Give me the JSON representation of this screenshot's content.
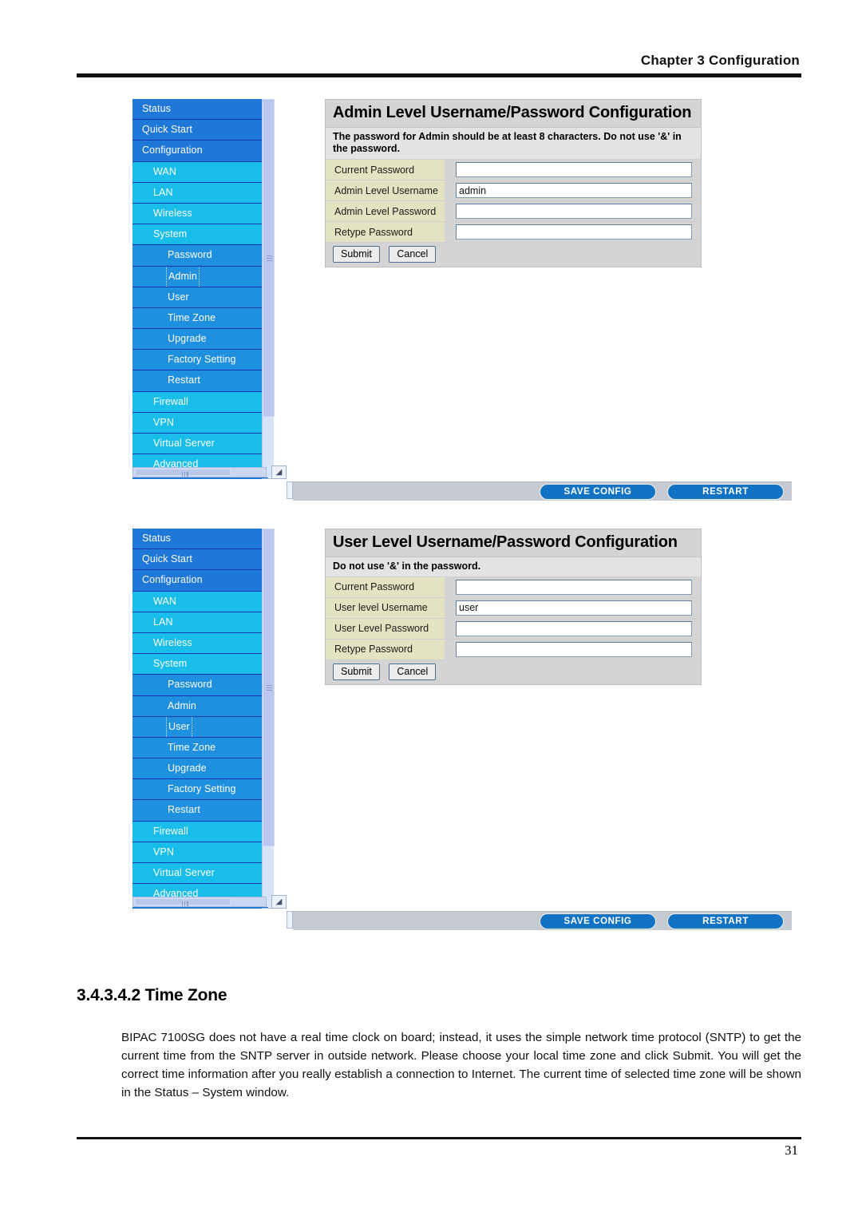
{
  "page": {
    "chapter_header": "Chapter 3 Configuration",
    "page_number": "31"
  },
  "menu": {
    "items": [
      {
        "label": "Status",
        "level": 0
      },
      {
        "label": "Quick Start",
        "level": 0
      },
      {
        "label": "Configuration",
        "level": 0
      },
      {
        "label": "WAN",
        "level": 1
      },
      {
        "label": "LAN",
        "level": 1
      },
      {
        "label": "Wireless",
        "level": 1
      },
      {
        "label": "System",
        "level": 1
      },
      {
        "label": "Password",
        "level": 2,
        "style": "blue"
      },
      {
        "label": "Admin",
        "level": 2,
        "style": "blue"
      },
      {
        "label": "User",
        "level": 2,
        "style": "blue"
      },
      {
        "label": "Time Zone",
        "level": 2,
        "style": "blue"
      },
      {
        "label": "Upgrade",
        "level": 2,
        "style": "blue"
      },
      {
        "label": "Factory Setting",
        "level": 2,
        "style": "blue"
      },
      {
        "label": "Restart",
        "level": 2,
        "style": "blue"
      },
      {
        "label": "Firewall",
        "level": 1
      },
      {
        "label": "VPN",
        "level": 1
      },
      {
        "label": "Virtual Server",
        "level": 1
      },
      {
        "label": "Advanced",
        "level": 1
      },
      {
        "label": "Save Config",
        "level": 0
      }
    ],
    "selected_admin": "Admin",
    "selected_user": "User"
  },
  "admin_panel": {
    "title": "Admin Level Username/Password Configuration",
    "note": "The password for Admin should be at least 8 characters. Do not use '&' in the password.",
    "fields": [
      {
        "label": "Current Password",
        "value": ""
      },
      {
        "label": "Admin Level Username",
        "value": "admin"
      },
      {
        "label": "Admin Level Password",
        "value": ""
      },
      {
        "label": "Retype Password",
        "value": ""
      }
    ],
    "submit_label": "Submit",
    "cancel_label": "Cancel"
  },
  "user_panel": {
    "title": "User Level Username/Password Configuration",
    "note": "Do not use '&' in the password.",
    "fields": [
      {
        "label": "Current Password",
        "value": ""
      },
      {
        "label": "User level Username",
        "value": "user"
      },
      {
        "label": "User Level Password",
        "value": ""
      },
      {
        "label": "Retype Password",
        "value": ""
      }
    ],
    "submit_label": "Submit",
    "cancel_label": "Cancel"
  },
  "action_bar": {
    "save_config_label": "SAVE CONFIG",
    "restart_label": "RESTART"
  },
  "section": {
    "heading": "3.4.3.4.2 Time Zone",
    "paragraph": "BIPAC 7100SG does not have a real time clock on board; instead, it uses the simple network time protocol (SNTP) to get the current time from the SNTP server in outside network. Please choose your local time zone and click Submit. You will get the correct time information after you really establish a connection to Internet. The current time of selected time zone will be shown in the Status – System window."
  },
  "colors": {
    "menu_top_level": "#1f77d8",
    "menu_sub_level": "#18bde9",
    "menu_deep_level": "#1f8fe0",
    "label_cell": "#e3e3c2",
    "panel_bg": "#d4d4d4",
    "action_pill": "#1272c4"
  }
}
